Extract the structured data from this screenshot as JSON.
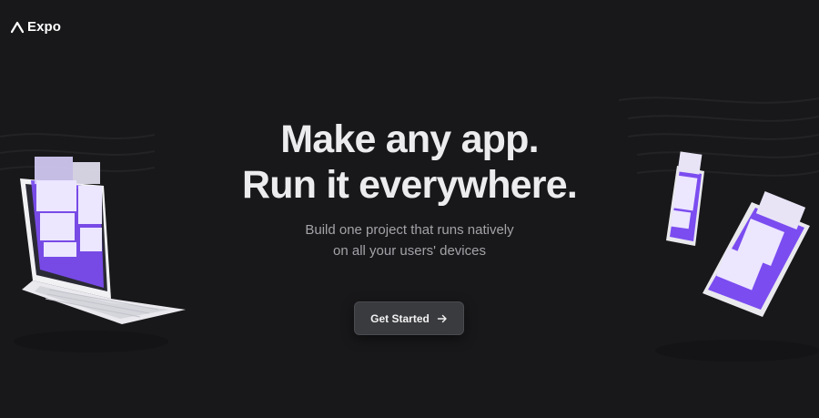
{
  "nav": {
    "logo_text": "Expo",
    "logo_icon": "expo-logo-icon"
  },
  "hero": {
    "headline_line1": "Make any app.",
    "headline_line2": "Run it everywhere.",
    "subhead_line1": "Build one project that runs natively",
    "subhead_line2": "on all your users' devices"
  },
  "cta": {
    "label": "Get Started",
    "icon": "arrow-right-icon"
  },
  "illustrations": {
    "left": "laptop-illustration",
    "right": "phone-tablet-illustration"
  },
  "colors": {
    "background": "#18181a",
    "headline": "#ececee",
    "subhead": "#a3a3a8",
    "button_bg": "#3a3b3e",
    "accent_purple": "#7b4cf0",
    "accent_lavender": "#e6dcff"
  }
}
